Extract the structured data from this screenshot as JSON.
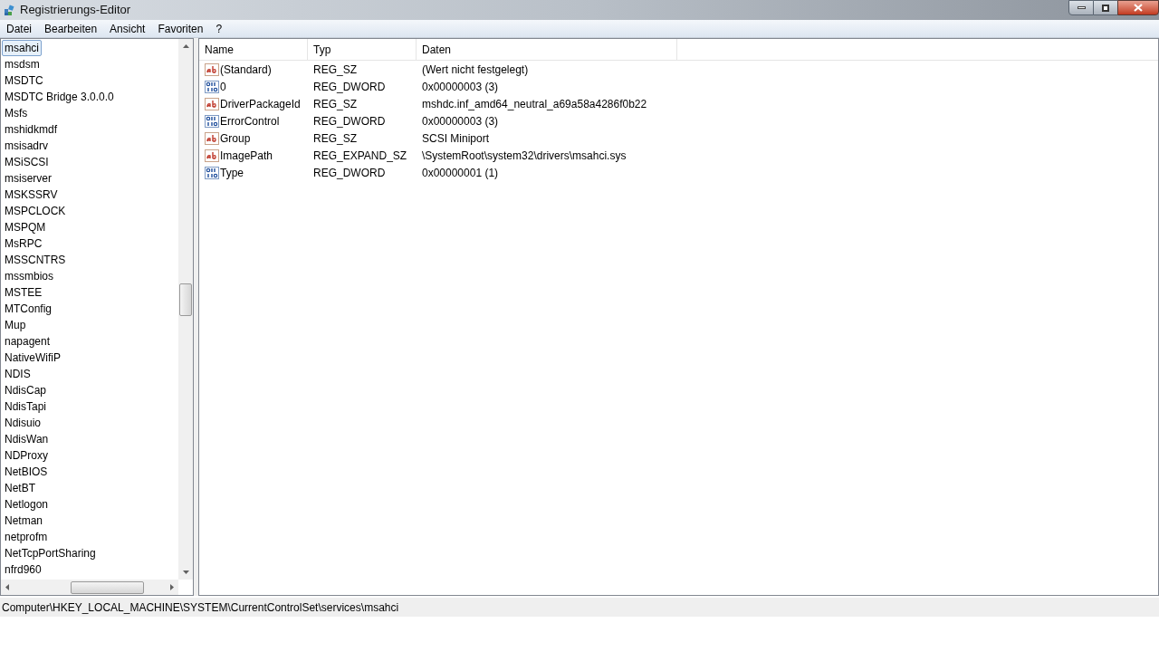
{
  "window": {
    "title": "Registrierungs-Editor"
  },
  "menu": [
    "Datei",
    "Bearbeiten",
    "Ansicht",
    "Favoriten",
    "?"
  ],
  "tree": {
    "items": [
      {
        "label": "msahci",
        "selected": true
      },
      {
        "label": "msdsm",
        "selected": false
      },
      {
        "label": "MSDTC",
        "selected": false
      },
      {
        "label": "MSDTC Bridge 3.0.0.0",
        "selected": false
      },
      {
        "label": "Msfs",
        "selected": false
      },
      {
        "label": "mshidkmdf",
        "selected": false
      },
      {
        "label": "msisadrv",
        "selected": false
      },
      {
        "label": "MSiSCSI",
        "selected": false
      },
      {
        "label": "msiserver",
        "selected": false
      },
      {
        "label": "MSKSSRV",
        "selected": false
      },
      {
        "label": "MSPCLOCK",
        "selected": false
      },
      {
        "label": "MSPQM",
        "selected": false
      },
      {
        "label": "MsRPC",
        "selected": false
      },
      {
        "label": "MSSCNTRS",
        "selected": false
      },
      {
        "label": "mssmbios",
        "selected": false
      },
      {
        "label": "MSTEE",
        "selected": false
      },
      {
        "label": "MTConfig",
        "selected": false
      },
      {
        "label": "Mup",
        "selected": false
      },
      {
        "label": "napagent",
        "selected": false
      },
      {
        "label": "NativeWifiP",
        "selected": false
      },
      {
        "label": "NDIS",
        "selected": false
      },
      {
        "label": "NdisCap",
        "selected": false
      },
      {
        "label": "NdisTapi",
        "selected": false
      },
      {
        "label": "Ndisuio",
        "selected": false
      },
      {
        "label": "NdisWan",
        "selected": false
      },
      {
        "label": "NDProxy",
        "selected": false
      },
      {
        "label": "NetBIOS",
        "selected": false
      },
      {
        "label": "NetBT",
        "selected": false
      },
      {
        "label": "Netlogon",
        "selected": false
      },
      {
        "label": "Netman",
        "selected": false
      },
      {
        "label": "netprofm",
        "selected": false
      },
      {
        "label": "NetTcpPortSharing",
        "selected": false
      },
      {
        "label": "nfrd960",
        "selected": false
      }
    ]
  },
  "values": {
    "columns": [
      "Name",
      "Typ",
      "Daten"
    ],
    "rows": [
      {
        "kind": "string",
        "name": "(Standard)",
        "type": "REG_SZ",
        "data": "(Wert nicht festgelegt)"
      },
      {
        "kind": "binary",
        "name": "0",
        "type": "REG_DWORD",
        "data": "0x00000003 (3)"
      },
      {
        "kind": "string",
        "name": "DriverPackageId",
        "type": "REG_SZ",
        "data": "mshdc.inf_amd64_neutral_a69a58a4286f0b22"
      },
      {
        "kind": "binary",
        "name": "ErrorControl",
        "type": "REG_DWORD",
        "data": "0x00000003 (3)"
      },
      {
        "kind": "string",
        "name": "Group",
        "type": "REG_SZ",
        "data": "SCSI Miniport"
      },
      {
        "kind": "string",
        "name": "ImagePath",
        "type": "REG_EXPAND_SZ",
        "data": "\\SystemRoot\\system32\\drivers\\msahci.sys"
      },
      {
        "kind": "binary",
        "name": "Type",
        "type": "REG_DWORD",
        "data": "0x00000001 (1)"
      }
    ]
  },
  "status_bar": "Computer\\HKEY_LOCAL_MACHINE\\SYSTEM\\CurrentControlSet\\services\\msahci"
}
